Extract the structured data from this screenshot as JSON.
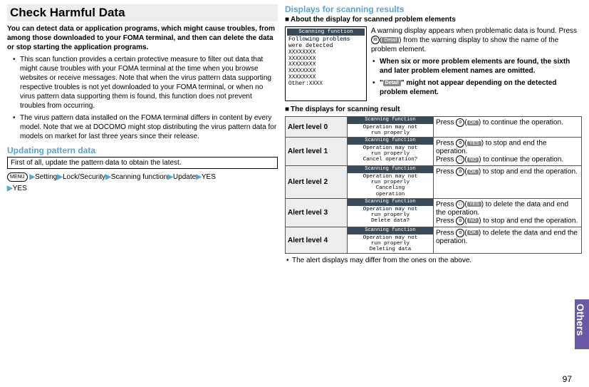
{
  "left": {
    "title": "Check Harmful Data",
    "intro": "You can detect data or application programs, which might cause troubles, from among those downloaded to your FOMA terminal, and then can delete the data or stop starting the application programs.",
    "bullet1": "This scan function provides a certain protective measure to filter out data that might cause troubles with your FOMA terminal at the time when you browse websites or receive messages. Note that when the virus pattern data supporting respective troubles is not yet downloaded to your FOMA terminal, or when no virus pattern data supporting them is found, this function does not prevent troubles from occurring.",
    "bullet2": "The virus pattern data installed on the FOMA terminal differs in content by every model. Note that we at DOCOMO might stop distributing the virus pattern data for models on market for last three years since their release.",
    "update_heading": "Updating pattern data",
    "update_note": "First of all, update the pattern data to obtain the latest.",
    "menu_icon": "MENU",
    "path": [
      "Setting",
      "Lock/Security",
      "Scanning function",
      "Update",
      "YES",
      "YES"
    ]
  },
  "right": {
    "heading": "Displays for scanning results",
    "about_sub": "About the display for scanned problem elements",
    "lcd_title": "Scanning function",
    "lcd_body": "Following problems\nwere detected\nXXXXXXXX\nXXXXXXXX\nXXXXXXXX\nXXXXXXXX\nXXXXXXXX\nOther:XXXX",
    "about_p1a": "A warning display appears when problematic data is found. Press ",
    "about_p1_btn_label": "Detail",
    "about_p1b": " from the warning display to show the name of the problem element.",
    "about_b1": "When six or more problem elements are found, the sixth and later problem element names are omitted.",
    "about_b2a": "\"",
    "about_b2_label": "Detail",
    "about_b2b": "\" might not appear depending on the detected problem element.",
    "table_sub": "The displays for scanning result",
    "levels": [
      {
        "name": "Alert level 0",
        "lcd": "Operation may not\nrun properly",
        "desc_parts": [
          {
            "t": "Press "
          },
          {
            "icon": "o"
          },
          {
            "t": "("
          },
          {
            "label": "OK"
          },
          {
            "t": ") to continue the operation."
          }
        ]
      },
      {
        "name": "Alert level 1",
        "lcd": "Operation may not\nrun properly\nCancel operation?",
        "desc_parts": [
          {
            "t": "Press "
          },
          {
            "icon": "o"
          },
          {
            "t": "("
          },
          {
            "label": "YES"
          },
          {
            "t": ") to stop and end the operation."
          },
          {
            "br": true
          },
          {
            "t": "Press "
          },
          {
            "icon": "□"
          },
          {
            "t": "("
          },
          {
            "label": "NO"
          },
          {
            "t": ") to continue the operation."
          }
        ]
      },
      {
        "name": "Alert level 2",
        "lcd": "Operation may not\nrun properly\nCanceling\noperation",
        "desc_parts": [
          {
            "t": "Press "
          },
          {
            "icon": "o"
          },
          {
            "t": "("
          },
          {
            "label": "OK"
          },
          {
            "t": ") to stop and end the operation."
          }
        ]
      },
      {
        "name": "Alert level 3",
        "lcd": "Operation may not\nrun properly\nDelete data?",
        "desc_parts": [
          {
            "t": "Press "
          },
          {
            "icon": "□"
          },
          {
            "t": "("
          },
          {
            "label": "YES"
          },
          {
            "t": ") to delete the data and end the operation."
          },
          {
            "br": true
          },
          {
            "t": "Press "
          },
          {
            "icon": "o"
          },
          {
            "t": "("
          },
          {
            "label": "NO"
          },
          {
            "t": ") to stop and end the operation."
          }
        ]
      },
      {
        "name": "Alert level 4",
        "lcd": "Operation may not\nrun properly\nDeleting data",
        "desc_parts": [
          {
            "t": "Press "
          },
          {
            "icon": "o"
          },
          {
            "t": "("
          },
          {
            "label": "OK"
          },
          {
            "t": ") to delete the data and end the operation."
          }
        ]
      }
    ],
    "footer_bullet": "The alert displays may differ from the ones on the above."
  },
  "side_tab": "Others",
  "page_number": "97"
}
